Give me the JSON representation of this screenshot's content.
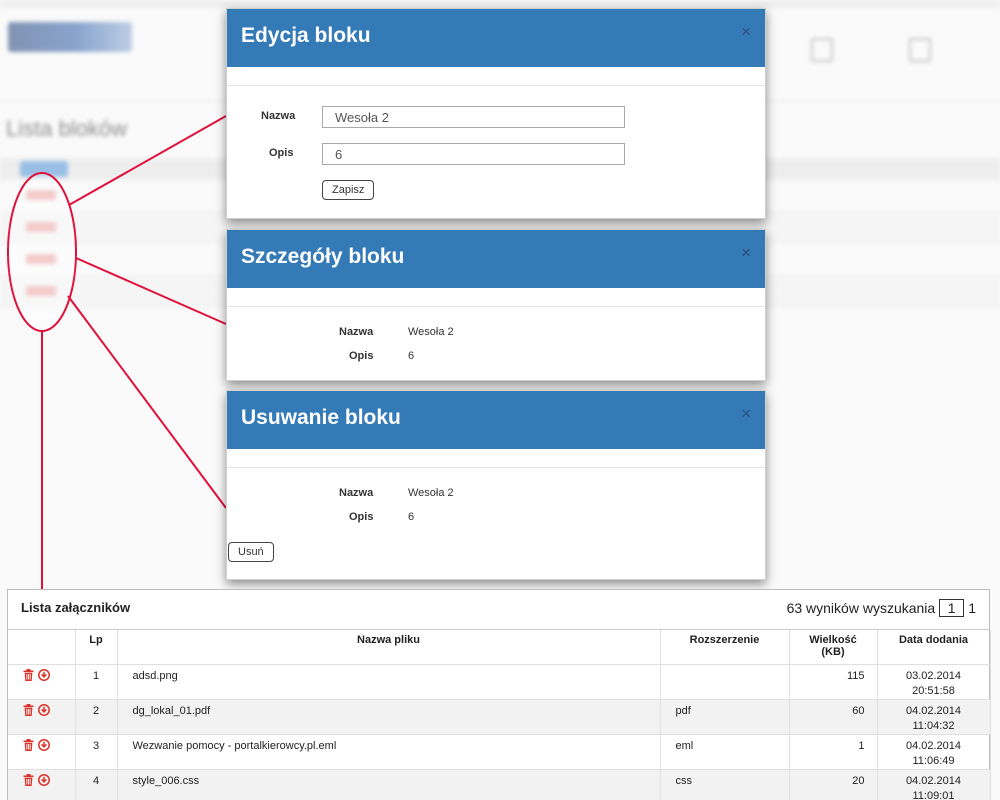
{
  "dialogs": {
    "edit": {
      "title": "Edycja bloku",
      "name_label": "Nazwa",
      "name_value": "Wesoła 2",
      "desc_label": "Opis",
      "desc_value": "6",
      "save_label": "Zapisz",
      "close_glyph": "×"
    },
    "details": {
      "title": "Szczegóły bloku",
      "name_label": "Nazwa",
      "name_value": "Wesoła 2",
      "desc_label": "Opis",
      "desc_value": "6",
      "close_glyph": "×"
    },
    "delete": {
      "title": "Usuwanie bloku",
      "name_label": "Nazwa",
      "name_value": "Wesoła 2",
      "desc_label": "Opis",
      "desc_value": "6",
      "delete_label": "Usuń",
      "close_glyph": "×"
    }
  },
  "background": {
    "page_title": "Lista bloków"
  },
  "attachments": {
    "title": "Lista załączników",
    "results_text": "63 wyników wyszukania",
    "current_page": "1",
    "total_pages": "1",
    "columns": {
      "lp": "Lp",
      "name": "Nazwa pliku",
      "ext": "Rozszerzenie",
      "size_line1": "Wielkość",
      "size_line2": "(KB)",
      "date": "Data dodania"
    },
    "rows": [
      {
        "lp": "1",
        "name": "adsd.png",
        "ext": "",
        "size": "115",
        "date": "03.02.2014",
        "time": "20:51:58"
      },
      {
        "lp": "2",
        "name": "dg_lokal_01.pdf",
        "ext": "pdf",
        "size": "60",
        "date": "04.02.2014",
        "time": "11:04:32"
      },
      {
        "lp": "3",
        "name": "Wezwanie pomocy - portalkierowcy.pl.eml",
        "ext": "eml",
        "size": "1",
        "date": "04.02.2014",
        "time": "11:06:49"
      },
      {
        "lp": "4",
        "name": "style_006.css",
        "ext": "css",
        "size": "20",
        "date": "04.02.2014",
        "time": "11:09:01"
      }
    ]
  },
  "colors": {
    "dialog_header": "#337ab7",
    "callout": "#e0103a",
    "action_icons": "#d9342b"
  },
  "icons": {
    "row_delete": "trash-icon",
    "row_download": "download-icon",
    "dialog_close": "close-icon"
  }
}
